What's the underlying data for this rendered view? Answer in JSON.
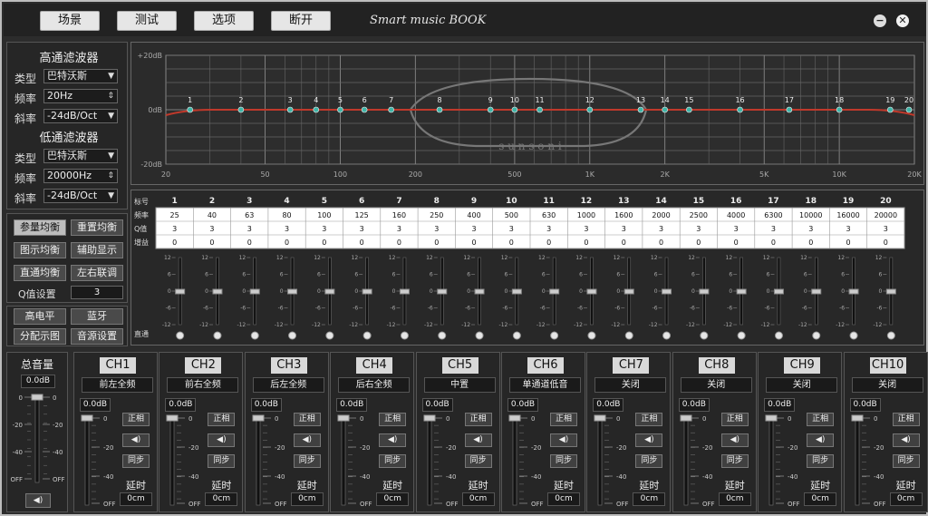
{
  "toolbar": {
    "buttons": [
      "场景",
      "测试",
      "选项",
      "断开"
    ],
    "brand": "Smart music BOOK"
  },
  "highpass": {
    "title": "高通滤波器",
    "type_label": "类型",
    "type": "巴特沃斯",
    "freq_label": "频率",
    "freq": "20Hz",
    "slope_label": "斜率",
    "slope": "-24dB/Oct"
  },
  "lowpass": {
    "title": "低通滤波器",
    "type_label": "类型",
    "type": "巴特沃斯",
    "freq_label": "频率",
    "freq": "20000Hz",
    "slope_label": "斜率",
    "slope": "-24dB/Oct"
  },
  "eq_buttons": {
    "param_eq": "参量均衡",
    "reset_eq": "重置均衡",
    "graphic_eq": "图示均衡",
    "aux_display": "辅助显示",
    "bypass_eq": "直通均衡",
    "lr_link": "左右联调",
    "q_label": "Q值设置",
    "q_value": "3"
  },
  "misc_buttons": {
    "high_level": "高电平",
    "bluetooth": "蓝牙",
    "dist_diagram": "分配示图",
    "source_setting": "音源设置"
  },
  "graph": {
    "y_top": "+20dB",
    "y_mid": "0dB",
    "y_bot": "-20dB",
    "x_ticks": [
      "20",
      "50",
      "100",
      "200",
      "500",
      "1K",
      "2K",
      "5K",
      "10K",
      "20K"
    ],
    "watermark": "s u n s o n i",
    "curve_color": "#c0392b"
  },
  "eq": {
    "row_labels": {
      "id": "标号",
      "freq": "频率",
      "q": "Q值",
      "gain": "增益",
      "bypass": "直通"
    },
    "bands": [
      1,
      2,
      3,
      4,
      5,
      6,
      7,
      8,
      9,
      10,
      11,
      12,
      13,
      14,
      15,
      16,
      17,
      18,
      19,
      20
    ],
    "freqs": [
      25,
      40,
      63,
      80,
      100,
      125,
      160,
      250,
      400,
      500,
      630,
      1000,
      1600,
      2000,
      2500,
      4000,
      6300,
      10000,
      16000,
      20000
    ],
    "q": [
      3,
      3,
      3,
      3,
      3,
      3,
      3,
      3,
      3,
      3,
      3,
      3,
      3,
      3,
      3,
      3,
      3,
      3,
      3,
      3
    ],
    "gain": [
      0,
      0,
      0,
      0,
      0,
      0,
      0,
      0,
      0,
      0,
      0,
      0,
      0,
      0,
      0,
      0,
      0,
      0,
      0,
      0
    ],
    "scale": [
      "12",
      "6",
      "0",
      "-6",
      "-12"
    ]
  },
  "master": {
    "title": "总音量",
    "value": "0.0dB",
    "scale_l": [
      "0",
      "-20",
      "-40",
      "OFF"
    ],
    "scale_r": [
      "0",
      "-20",
      "-40",
      "OFF"
    ]
  },
  "channel_labels": {
    "phase": "正相",
    "sync": "同步",
    "delay": "延时",
    "scale": [
      "0",
      "-20",
      "-40",
      "OFF"
    ]
  },
  "channels": [
    {
      "name": "CH1",
      "assign": "前左全频",
      "gain": "0.0dB",
      "delay": "0cm"
    },
    {
      "name": "CH2",
      "assign": "前右全频",
      "gain": "0.0dB",
      "delay": "0cm"
    },
    {
      "name": "CH3",
      "assign": "后左全频",
      "gain": "0.0dB",
      "delay": "0cm"
    },
    {
      "name": "CH4",
      "assign": "后右全频",
      "gain": "0.0dB",
      "delay": "0cm"
    },
    {
      "name": "CH5",
      "assign": "中置",
      "gain": "0.0dB",
      "delay": "0cm"
    },
    {
      "name": "CH6",
      "assign": "单通道低音",
      "gain": "0.0dB",
      "delay": "0cm"
    },
    {
      "name": "CH7",
      "assign": "关闭",
      "gain": "0.0dB",
      "delay": "0cm"
    },
    {
      "name": "CH8",
      "assign": "关闭",
      "gain": "0.0dB",
      "delay": "0cm"
    },
    {
      "name": "CH9",
      "assign": "关闭",
      "gain": "0.0dB",
      "delay": "0cm"
    },
    {
      "name": "CH10",
      "assign": "关闭",
      "gain": "0.0dB",
      "delay": "0cm"
    }
  ]
}
